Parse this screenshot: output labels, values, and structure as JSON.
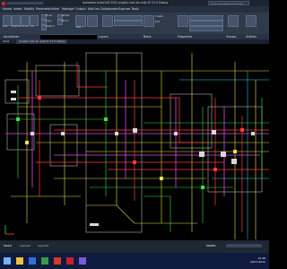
{
  "app": {
    "title": "Autodesk AutoCAD 2022    projeto ciat de rede IV V1-V Dabrg",
    "search_placeholder": "Type a keyword or phrase"
  },
  "menus": [
    "Home",
    "Insert",
    "Modify",
    "Parametric",
    "View",
    "Manage",
    "Output",
    "Add-ins",
    "Collaborate",
    "Express Tools"
  ],
  "ribbon": {
    "groups": [
      "Annotation",
      "Layers",
      "Block",
      "Properties",
      "Groups",
      "Utilities"
    ],
    "tools": [
      "Line",
      "Polyline",
      "Circle",
      "Arc",
      "Move",
      "Copy",
      "Rotate",
      "Mirror",
      "Stretch",
      "Text",
      "Dimension",
      "Layer Properties",
      "Insert",
      "Create",
      "Edit",
      "Match Properties",
      "Group",
      "Measure"
    ]
  },
  "file_tabs": [
    "Start",
    "projeto ciat de rede IV V1-V Dabrg"
  ],
  "model_tabs": [
    "Model",
    "Layout1",
    "Layout2"
  ],
  "status": {
    "model": "MODEL"
  },
  "clock": {
    "time": "10:48",
    "date": "29/07/2022"
  },
  "colors": {
    "ribbon_bg": "#2f3a4b",
    "drawing_bg": "#000000",
    "line_yellow": "#e8e14a",
    "line_red": "#ff3b3b",
    "line_green": "#38e04a",
    "line_magenta": "#e04ae8",
    "line_white": "#d8d8d8",
    "line_cyan": "#3ad8e8",
    "autocad_red": "#c8202f"
  }
}
